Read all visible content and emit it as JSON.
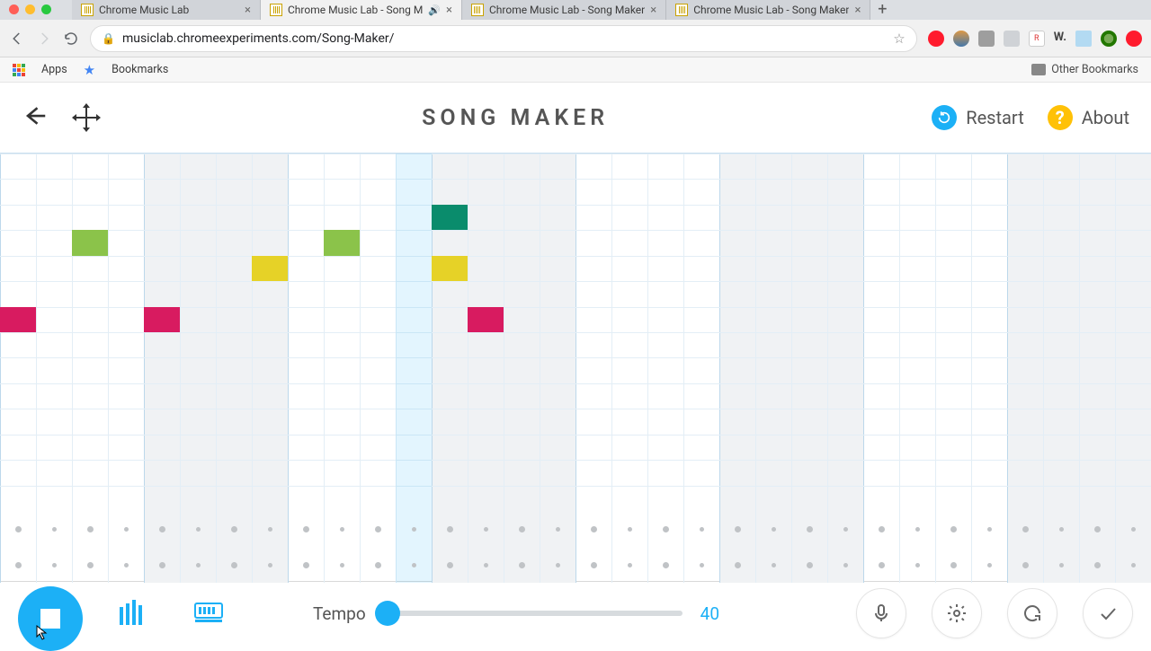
{
  "browser": {
    "tabs": [
      {
        "title": "Chrome Music Lab",
        "active": false
      },
      {
        "title": "Chrome Music Lab - Song M",
        "active": true,
        "audio": true
      },
      {
        "title": "Chrome Music Lab - Song Maker",
        "active": false
      },
      {
        "title": "Chrome Music Lab - Song Maker",
        "active": false
      }
    ],
    "url": "musiclab.chromeexperiments.com/Song-Maker/",
    "bookmarks": {
      "apps": "Apps",
      "bookmarks": "Bookmarks",
      "other": "Other Bookmarks"
    }
  },
  "app": {
    "title": "SONG MAKER",
    "restart": "Restart",
    "about": "About"
  },
  "grid": {
    "cols": 32,
    "melody_rows": 14,
    "rhythm_rows": 2,
    "beat_group": 4,
    "dark_groups": [
      1,
      3,
      5,
      7
    ],
    "playhead_col": 11,
    "notes": [
      {
        "row": 2,
        "col": 12,
        "color": "#0a8c6c"
      },
      {
        "row": 3,
        "col": 2,
        "color": "#8bc34a"
      },
      {
        "row": 3,
        "col": 9,
        "color": "#8bc34a"
      },
      {
        "row": 4,
        "col": 7,
        "color": "#e6d227"
      },
      {
        "row": 4,
        "col": 12,
        "color": "#e6d227"
      },
      {
        "row": 6,
        "col": 0,
        "color": "#d81b60"
      },
      {
        "row": 6,
        "col": 4,
        "color": "#d81b60"
      },
      {
        "row": 6,
        "col": 13,
        "color": "#d81b60"
      }
    ]
  },
  "controls": {
    "tempo_label": "Tempo",
    "tempo_value": "40",
    "tempo_min": 40,
    "tempo_max": 240,
    "tempo_pct": 0.02
  }
}
